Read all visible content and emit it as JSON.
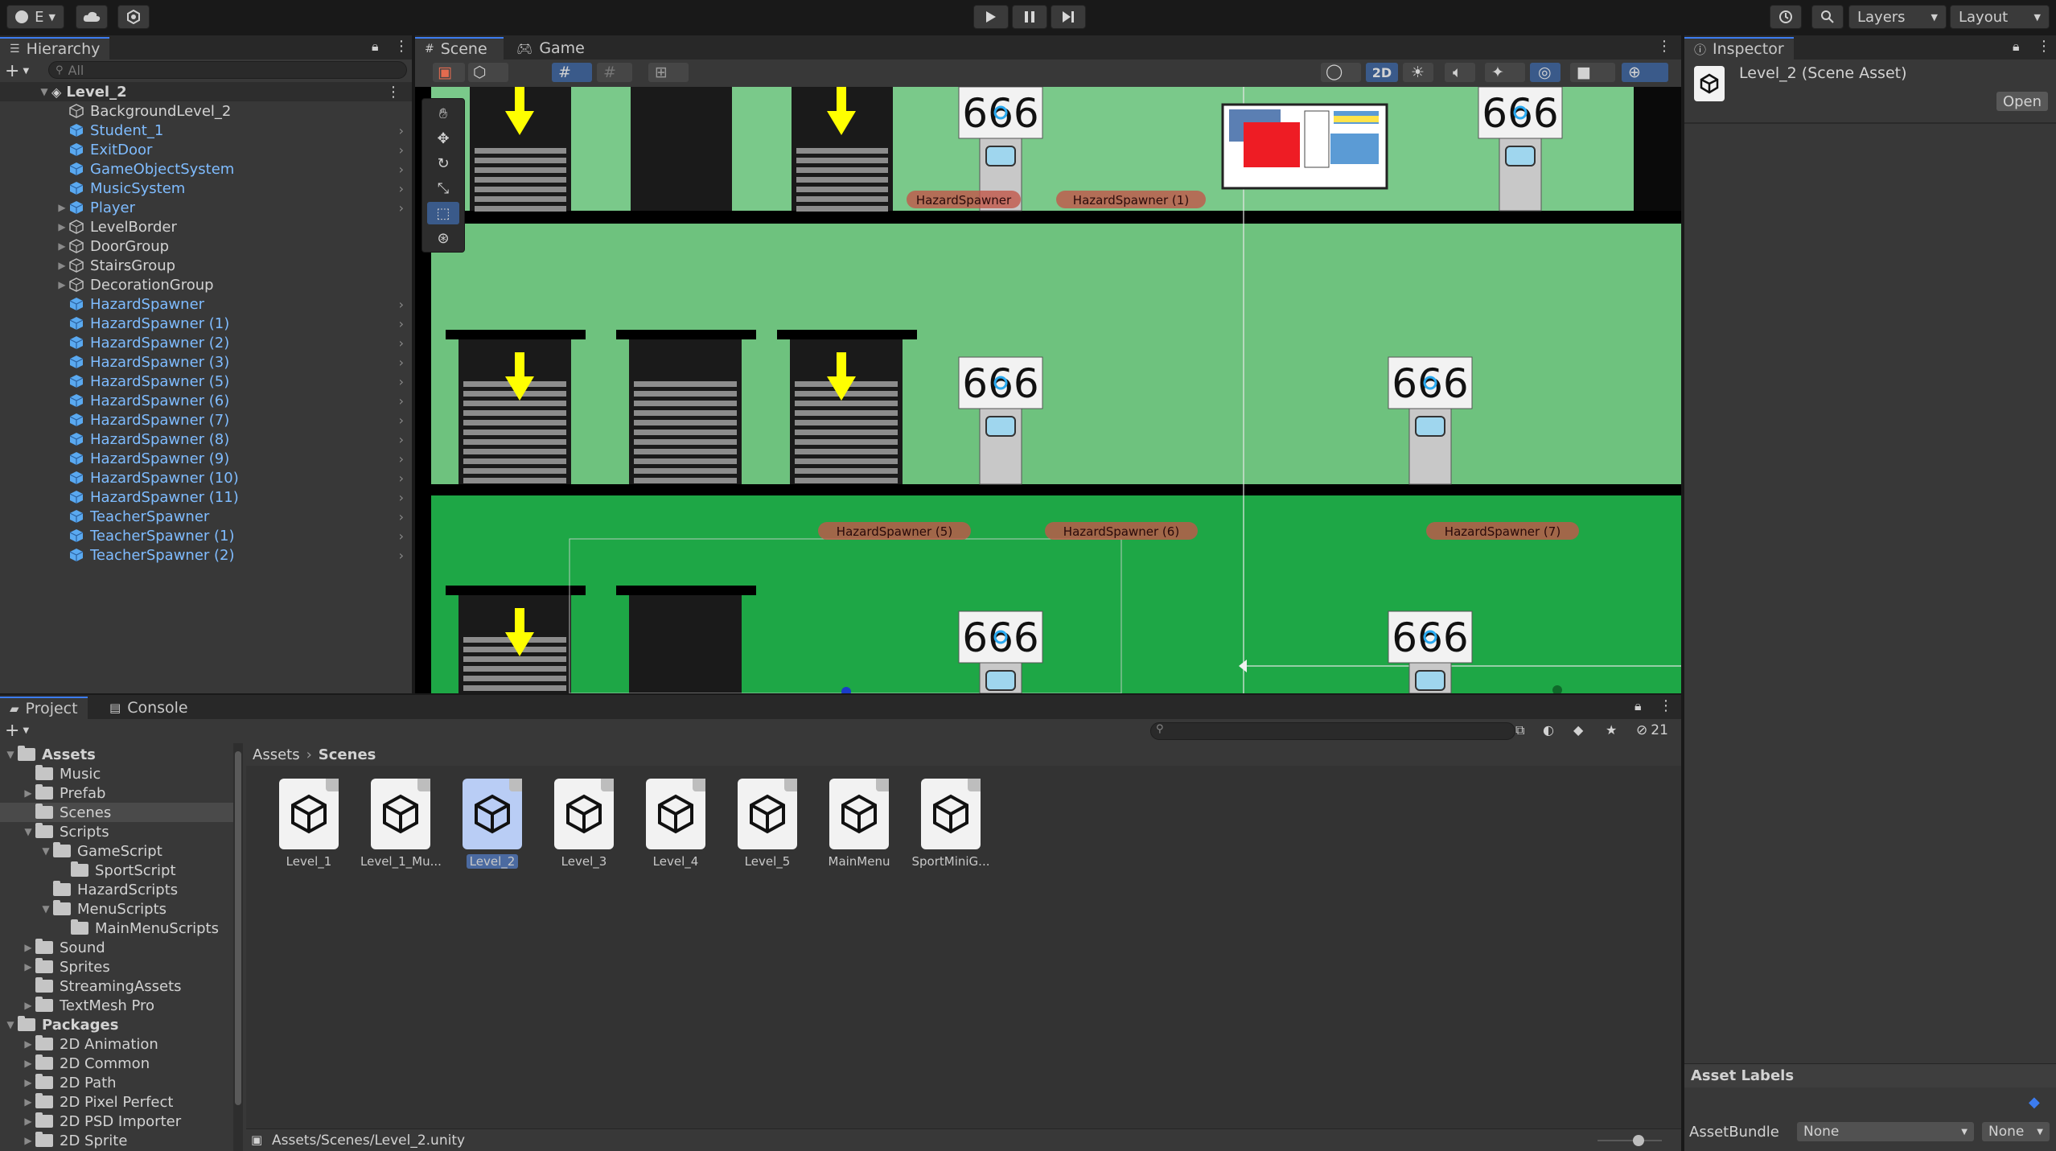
{
  "toolbar": {
    "account_label": "E",
    "layers_label": "Layers",
    "layout_label": "Layout",
    "icons": [
      "account-icon",
      "cloud-icon",
      "collab-icon",
      "play-icon",
      "pause-icon",
      "step-icon",
      "history-icon",
      "search-icon"
    ]
  },
  "hierarchy": {
    "tab_label": "Hierarchy",
    "search_placeholder": "All",
    "scene_name": "Level_2",
    "items": [
      {
        "label": "BackgroundLevel_2",
        "prefab": false,
        "expandable": false
      },
      {
        "label": "Student_1",
        "prefab": true,
        "expandable": false
      },
      {
        "label": "ExitDoor",
        "prefab": true,
        "expandable": false
      },
      {
        "label": "GameObjectSystem",
        "prefab": true,
        "expandable": false
      },
      {
        "label": "MusicSystem",
        "prefab": true,
        "expandable": false
      },
      {
        "label": "Player",
        "prefab": true,
        "expandable": true
      },
      {
        "label": "LevelBorder",
        "prefab": false,
        "expandable": true
      },
      {
        "label": "DoorGroup",
        "prefab": false,
        "expandable": true
      },
      {
        "label": "StairsGroup",
        "prefab": false,
        "expandable": true
      },
      {
        "label": "DecorationGroup",
        "prefab": false,
        "expandable": true
      },
      {
        "label": "HazardSpawner",
        "prefab": true,
        "expandable": false
      },
      {
        "label": "HazardSpawner (1)",
        "prefab": true,
        "expandable": false
      },
      {
        "label": "HazardSpawner (2)",
        "prefab": true,
        "expandable": false
      },
      {
        "label": "HazardSpawner (3)",
        "prefab": true,
        "expandable": false
      },
      {
        "label": "HazardSpawner (5)",
        "prefab": true,
        "expandable": false
      },
      {
        "label": "HazardSpawner (6)",
        "prefab": true,
        "expandable": false
      },
      {
        "label": "HazardSpawner (7)",
        "prefab": true,
        "expandable": false
      },
      {
        "label": "HazardSpawner (8)",
        "prefab": true,
        "expandable": false
      },
      {
        "label": "HazardSpawner (9)",
        "prefab": true,
        "expandable": false
      },
      {
        "label": "HazardSpawner (10)",
        "prefab": true,
        "expandable": false
      },
      {
        "label": "HazardSpawner (11)",
        "prefab": true,
        "expandable": false
      },
      {
        "label": "TeacherSpawner",
        "prefab": true,
        "expandable": false
      },
      {
        "label": "TeacherSpawner (1)",
        "prefab": true,
        "expandable": false
      },
      {
        "label": "TeacherSpawner (2)",
        "prefab": true,
        "expandable": false
      }
    ]
  },
  "scene": {
    "tabs": [
      "Scene",
      "Game"
    ],
    "mode_2d": "2D",
    "room_number": "666",
    "spawner_labels": [
      "HazardSpawner",
      "HazardSpawner (1)",
      "HazardSpawner (5)",
      "HazardSpawner (6)",
      "HazardSpawner (7)"
    ]
  },
  "inspector": {
    "tab_label": "Inspector",
    "asset_title": "Level_2 (Scene Asset)",
    "open_button": "Open",
    "asset_labels": "Asset Labels",
    "assetbundle_label": "AssetBundle",
    "assetbundle_value": "None",
    "variant_value": "None"
  },
  "project": {
    "tabs": [
      "Project",
      "Console"
    ],
    "hidden_count": "21",
    "breadcrumb": [
      "Assets",
      "Scenes"
    ],
    "tree": [
      {
        "label": "Assets",
        "level": 0,
        "bold": true,
        "arrow": "down"
      },
      {
        "label": "Music",
        "level": 1,
        "arrow": ""
      },
      {
        "label": "Prefab",
        "level": 1,
        "arrow": "right"
      },
      {
        "label": "Scenes",
        "level": 1,
        "arrow": "",
        "selected": true
      },
      {
        "label": "Scripts",
        "level": 1,
        "arrow": "down"
      },
      {
        "label": "GameScript",
        "level": 2,
        "arrow": "down"
      },
      {
        "label": "SportScript",
        "level": 3,
        "arrow": ""
      },
      {
        "label": "HazardScripts",
        "level": 2,
        "arrow": ""
      },
      {
        "label": "MenuScripts",
        "level": 2,
        "arrow": "down"
      },
      {
        "label": "MainMenuScripts",
        "level": 3,
        "arrow": ""
      },
      {
        "label": "Sound",
        "level": 1,
        "arrow": "right"
      },
      {
        "label": "Sprites",
        "level": 1,
        "arrow": "right"
      },
      {
        "label": "StreamingAssets",
        "level": 1,
        "arrow": ""
      },
      {
        "label": "TextMesh Pro",
        "level": 1,
        "arrow": "right"
      },
      {
        "label": "Packages",
        "level": 0,
        "bold": true,
        "arrow": "down"
      },
      {
        "label": "2D Animation",
        "level": 1,
        "arrow": "right"
      },
      {
        "label": "2D Common",
        "level": 1,
        "arrow": "right"
      },
      {
        "label": "2D Path",
        "level": 1,
        "arrow": "right"
      },
      {
        "label": "2D Pixel Perfect",
        "level": 1,
        "arrow": "right"
      },
      {
        "label": "2D PSD Importer",
        "level": 1,
        "arrow": "right"
      },
      {
        "label": "2D Sprite",
        "level": 1,
        "arrow": "right"
      }
    ],
    "assets": [
      "Level_1",
      "Level_1_Mu...",
      "Level_2",
      "Level_3",
      "Level_4",
      "Level_5",
      "MainMenu",
      "SportMiniG..."
    ],
    "selected_asset": "Level_2",
    "path": "Assets/Scenes/Level_2.unity"
  }
}
